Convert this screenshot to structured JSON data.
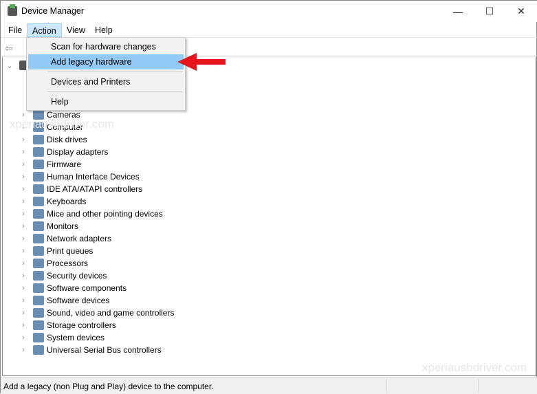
{
  "window": {
    "title": "Device Manager",
    "controls": {
      "minimize": "—",
      "maximize": "☐",
      "close": "✕"
    }
  },
  "menubar": [
    "File",
    "Action",
    "View",
    "Help"
  ],
  "action_menu": {
    "items": [
      "Scan for hardware changes",
      "Add legacy hardware",
      "Devices and Printers",
      "Help"
    ],
    "highlighted": "Add legacy hardware"
  },
  "tree": {
    "categories": [
      "Cameras",
      "Computer",
      "Disk drives",
      "Display adapters",
      "Firmware",
      "Human Interface Devices",
      "IDE ATA/ATAPI controllers",
      "Keyboards",
      "Mice and other pointing devices",
      "Monitors",
      "Network adapters",
      "Print queues",
      "Processors",
      "Security devices",
      "Software components",
      "Software devices",
      "Sound, video and game controllers",
      "Storage controllers",
      "System devices",
      "Universal Serial Bus controllers"
    ]
  },
  "status": "Add a legacy (non Plug and Play) device to the computer.",
  "watermark": "xperiausbdriver.com",
  "colors": {
    "highlight": "#91c9f7",
    "arrow": "#e8141c"
  }
}
